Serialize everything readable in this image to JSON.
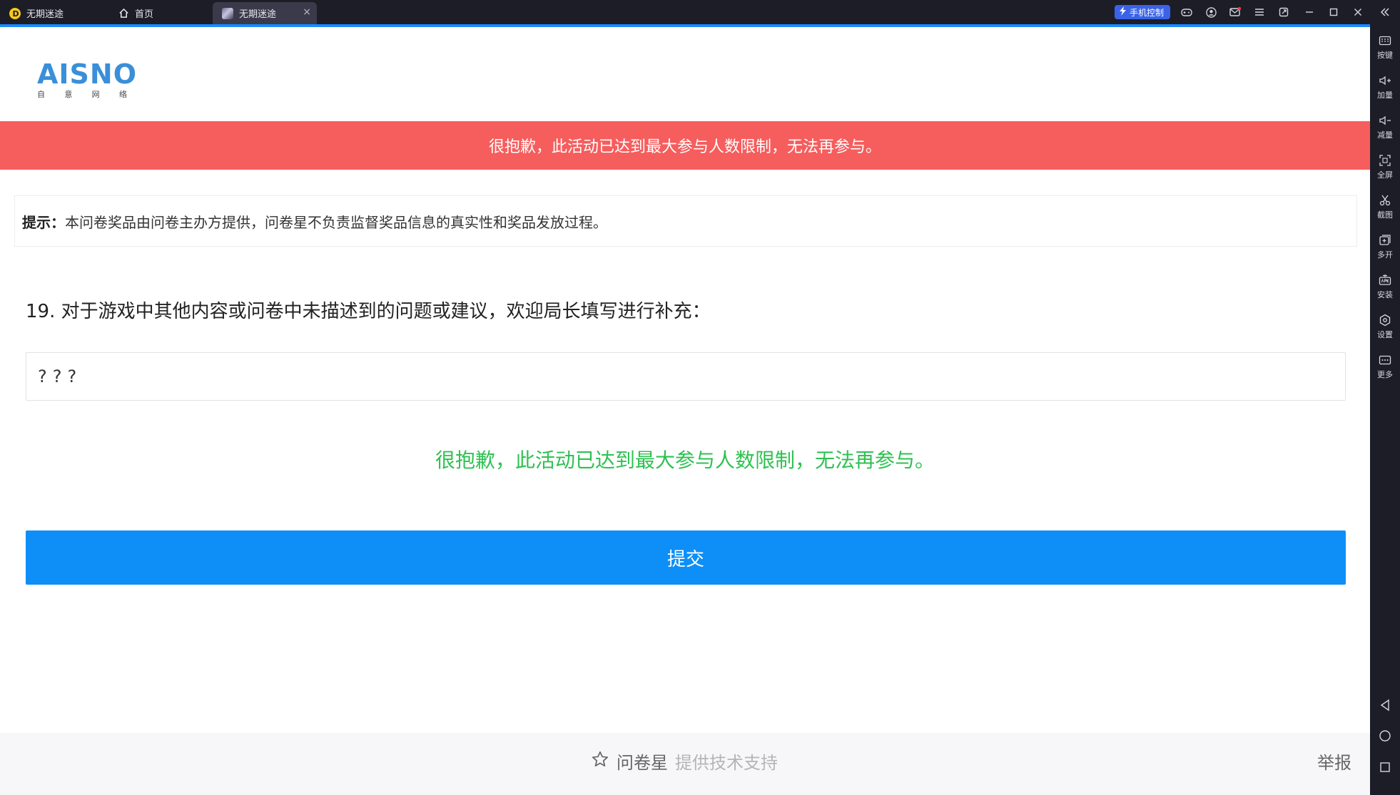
{
  "titlebar": {
    "app_tab_label": "无期迷途",
    "home_tab_label": "首页",
    "active_tab_label": "无期迷途",
    "close_glyph": "×",
    "phone_control_label": "手机控制",
    "accent_color": "#1a8cff",
    "window_icons": [
      "gamepad-icon",
      "account-icon",
      "mail-icon",
      "menu-icon",
      "restore-icon",
      "minimize-icon",
      "maximize-icon",
      "close-icon"
    ]
  },
  "sidebar": {
    "items": [
      {
        "label": "按键",
        "icon": "keyboard-icon"
      },
      {
        "label": "加量",
        "icon": "volume-up-icon"
      },
      {
        "label": "减量",
        "icon": "volume-down-icon"
      },
      {
        "label": "全屏",
        "icon": "fullscreen-icon"
      },
      {
        "label": "截图",
        "icon": "scissors-icon"
      },
      {
        "label": "多开",
        "icon": "multi-instance-icon"
      },
      {
        "label": "安装",
        "icon": "apk-install-icon"
      },
      {
        "label": "设置",
        "icon": "settings-icon"
      },
      {
        "label": "更多",
        "icon": "more-icon"
      }
    ],
    "nav": [
      "back-icon",
      "home-circle-icon",
      "recent-square-icon"
    ]
  },
  "page": {
    "logo": {
      "text": "AISNO",
      "sub": [
        "自",
        "意",
        "网",
        "络"
      ]
    },
    "banner_text": "很抱歉，此活动已达到最大参与人数限制，无法再参与。",
    "banner_color": "#f65d5d",
    "tip_label": "提示：",
    "tip_text": "本问卷奖品由问卷主办方提供，问卷星不负责监督奖品信息的真实性和奖品发放过程。",
    "question": "19. 对于游戏中其他内容或问卷中未描述到的问题或建议，欢迎局长填写进行补充：",
    "answer_value": "???",
    "limit_message": "很抱歉，此活动已达到最大参与人数限制，无法再参与。",
    "limit_color": "#2ec151",
    "submit_label": "提交",
    "submit_color": "#0d8ff7",
    "footer": {
      "brand": "问卷星",
      "support": "提供技术支持",
      "report": "举报"
    }
  }
}
